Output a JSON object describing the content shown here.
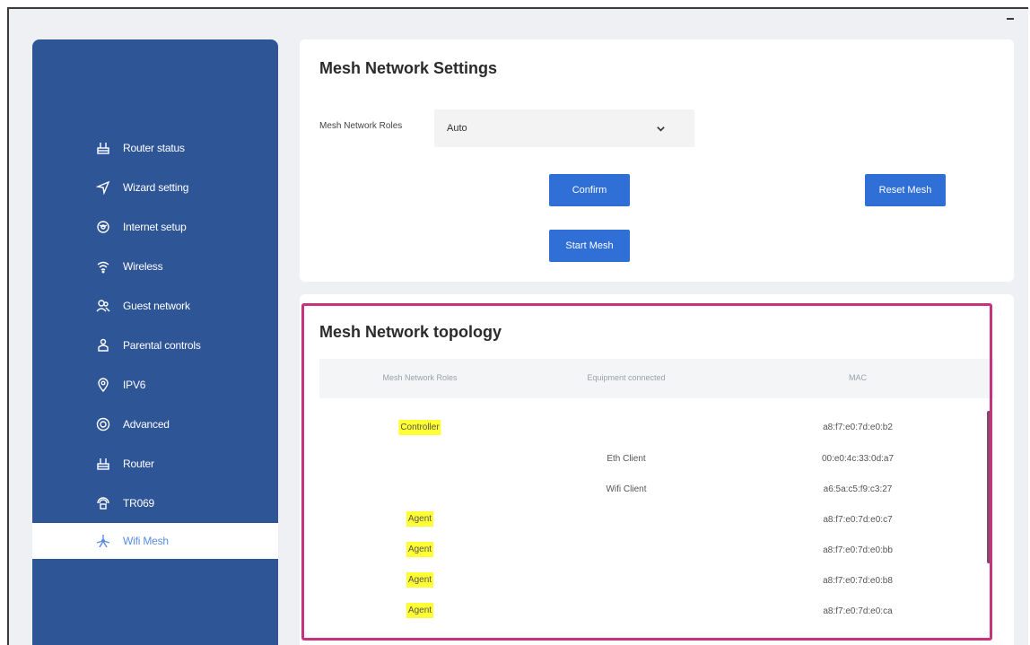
{
  "sidebar": {
    "items": [
      {
        "label": "Router status",
        "icon": "router-status-icon"
      },
      {
        "label": "Wizard setting",
        "icon": "navigate-arrow-icon"
      },
      {
        "label": "Internet setup",
        "icon": "globe-icon"
      },
      {
        "label": "Wireless",
        "icon": "wifi-icon"
      },
      {
        "label": "Guest network",
        "icon": "guests-icon"
      },
      {
        "label": "Parental controls",
        "icon": "parent-icon"
      },
      {
        "label": "IPV6",
        "icon": "ipv6-icon"
      },
      {
        "label": "Advanced",
        "icon": "advanced-icon"
      },
      {
        "label": "Router",
        "icon": "router-icon"
      },
      {
        "label": "TR069",
        "icon": "tr069-icon"
      },
      {
        "label": "Wifi Mesh",
        "icon": "mesh-icon",
        "active": true
      }
    ]
  },
  "settings": {
    "title": "Mesh Network Settings",
    "roles_label": "Mesh Network Roles",
    "roles_value": "Auto",
    "confirm_label": "Confirm",
    "reset_label": "Reset Mesh",
    "start_label": "Start Mesh"
  },
  "topology": {
    "title": "Mesh Network topology",
    "columns": [
      "Mesh Network Roles",
      "Equipment connected",
      "MAC"
    ],
    "rows": [
      {
        "role": "Controller",
        "equipment": "",
        "mac": "a8:f7:e0:7d:e0:b2"
      },
      {
        "role": "",
        "equipment": "Eth Client",
        "mac": "00:e0:4c:33:0d:a7"
      },
      {
        "role": "",
        "equipment": "Wifi Client",
        "mac": "a6:5a:c5:f9:c3:27"
      },
      {
        "role": "Agent",
        "equipment": "",
        "mac": "a8:f7:e0:7d:e0:c7"
      },
      {
        "role": "Agent",
        "equipment": "",
        "mac": "a8:f7:e0:7d:e0:bb"
      },
      {
        "role": "Agent",
        "equipment": "",
        "mac": "a8:f7:e0:7d:e0:b8"
      },
      {
        "role": "Agent",
        "equipment": "",
        "mac": "a8:f7:e0:7d:e0:ca"
      }
    ]
  },
  "colors": {
    "sidebar": "#2e5596",
    "button": "#2f6fd6",
    "highlight": "#ffff33",
    "annotation_border": "#c4337c"
  }
}
